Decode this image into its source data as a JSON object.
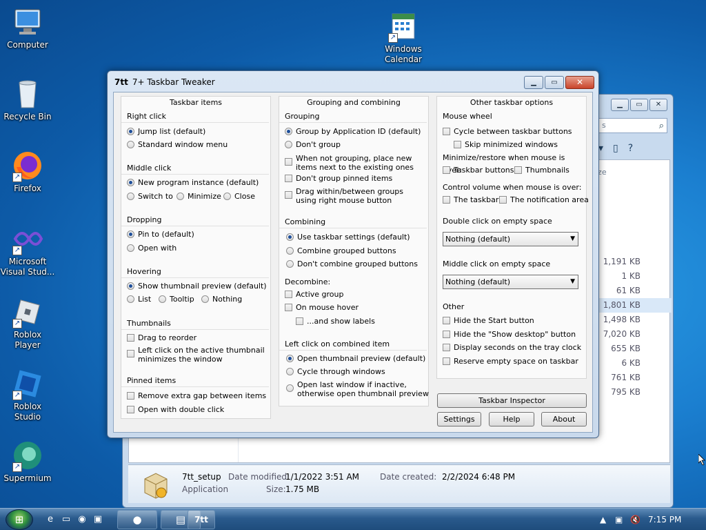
{
  "desktop": {
    "icons": [
      {
        "label": "Computer",
        "icon": "computer-icon"
      },
      {
        "label": "Recycle Bin",
        "icon": "recycle-bin-icon"
      },
      {
        "label": "Firefox",
        "icon": "firefox-icon"
      },
      {
        "label": "Microsoft Visual Stud...",
        "icon": "visual-studio-icon"
      },
      {
        "label": "Roblox Player",
        "icon": "roblox-player-icon"
      },
      {
        "label": "Roblox Studio",
        "icon": "roblox-studio-icon"
      },
      {
        "label": "Supermium",
        "icon": "supermium-icon"
      },
      {
        "label": "Windows Calendar",
        "icon": "calendar-icon"
      }
    ]
  },
  "explorer": {
    "search_placeholder": "s",
    "col_size_header": "ize",
    "sizes": [
      "1,191 KB",
      "1 KB",
      "61 KB",
      "1,801 KB",
      "1,498 KB",
      "7,020 KB",
      "655 KB",
      "6 KB",
      "761 KB",
      "795 KB"
    ],
    "details": {
      "name": "7tt_setup",
      "type": "Application",
      "date_modified_label": "Date modified:",
      "date_modified": "1/1/2022 3:51 AM",
      "size_label": "Size:",
      "size": "1.75 MB",
      "date_created_label": "Date created:",
      "date_created": "2/2/2024 6:48 PM"
    }
  },
  "window": {
    "title": "7+ Taskbar Tweaker",
    "app_icon_text": "7tt"
  },
  "col1": {
    "header": "Taskbar items",
    "right_click": {
      "title": "Right click",
      "options": [
        "Jump list (default)",
        "Standard window menu"
      ]
    },
    "middle_click": {
      "title": "Middle click",
      "options": [
        "New program instance (default)",
        "Switch to",
        "Minimize",
        "Close"
      ]
    },
    "dropping": {
      "title": "Dropping",
      "options": [
        "Pin to (default)",
        "Open with"
      ]
    },
    "hovering": {
      "title": "Hovering",
      "options": [
        "Show thumbnail preview (default)",
        "List",
        "Tooltip",
        "Nothing"
      ]
    },
    "thumbnails": {
      "title": "Thumbnails",
      "options": [
        "Drag to reorder",
        "Left click on the active thumbnail",
        "minimizes the window"
      ]
    },
    "pinned": {
      "title": "Pinned items",
      "options": [
        "Remove extra gap between items",
        "Open with double click"
      ]
    }
  },
  "col2": {
    "header": "Grouping and combining",
    "grouping": {
      "title": "Grouping",
      "options": [
        "Group by Application ID (default)",
        "Don't group",
        "When not grouping, place new",
        "items next to the existing ones",
        "Don't group pinned items",
        "Drag within/between groups",
        "using right mouse button"
      ]
    },
    "combining": {
      "title": "Combining",
      "options": [
        "Use taskbar settings (default)",
        "Combine grouped buttons",
        "Don't combine grouped buttons"
      ]
    },
    "decombine": {
      "title": "Decombine:",
      "options": [
        "Active group",
        "On mouse hover",
        "...and show labels"
      ]
    },
    "left_click": {
      "title": "Left click on combined item",
      "options": [
        "Open thumbnail preview (default)",
        "Cycle through windows",
        "Open last window if inactive,",
        "otherwise open thumbnail preview"
      ]
    }
  },
  "col3": {
    "header": "Other taskbar options",
    "mouse_wheel": {
      "title": "Mouse wheel",
      "options": [
        "Cycle between taskbar buttons",
        "Skip minimized windows"
      ]
    },
    "minimize": {
      "title": "Minimize/restore when mouse is over:",
      "options": [
        "Taskbar buttons",
        "Thumbnails"
      ]
    },
    "volume": {
      "title": "Control volume when mouse is over:",
      "options": [
        "The taskbar",
        "The notification area"
      ]
    },
    "double_click": {
      "title": "Double click on empty space",
      "value": "Nothing (default)"
    },
    "middle_click_empty": {
      "title": "Middle click on empty space",
      "value": "Nothing (default)"
    },
    "other": {
      "title": "Other",
      "options": [
        "Hide the Start button",
        "Hide the \"Show desktop\" button",
        "Display seconds on the tray clock",
        "Reserve empty space on taskbar"
      ]
    }
  },
  "buttons": {
    "inspector": "Taskbar Inspector",
    "settings": "Settings",
    "help": "Help",
    "about": "About"
  },
  "taskbar": {
    "clock": "7:15 PM"
  }
}
